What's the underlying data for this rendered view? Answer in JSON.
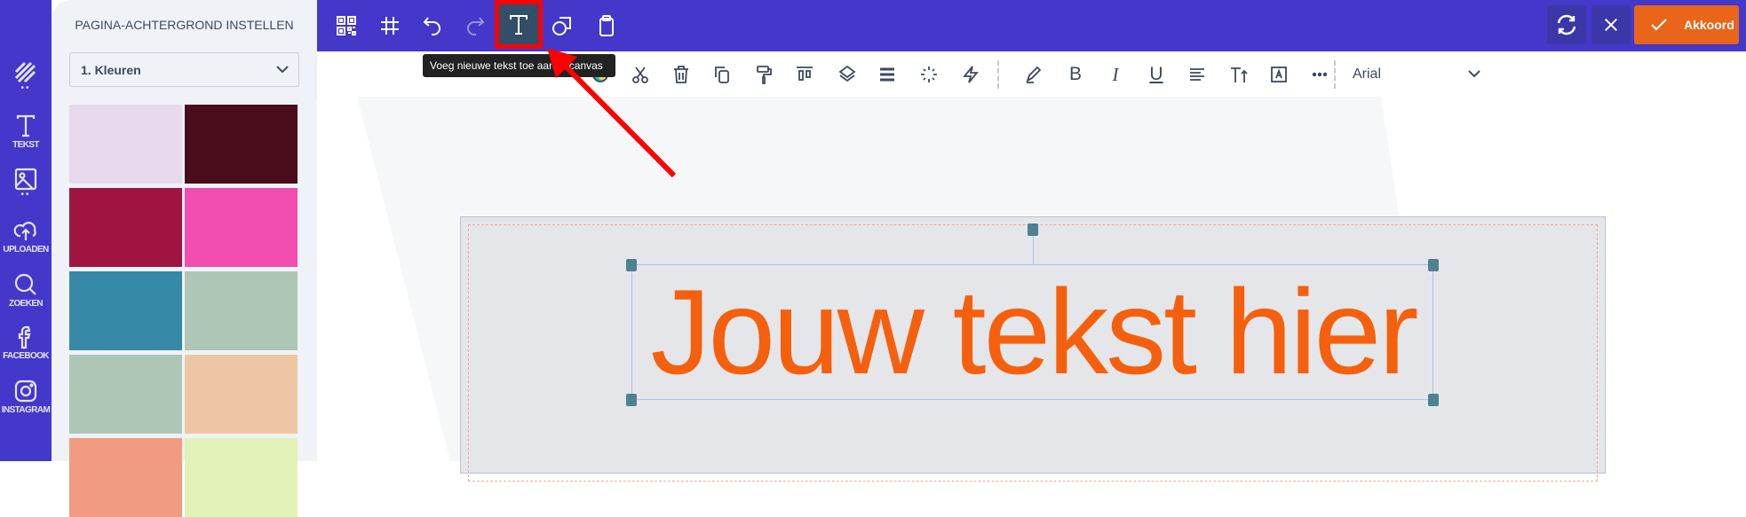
{
  "rail": {
    "items": [
      {
        "icon": "stripes-icon",
        "label": ""
      },
      {
        "icon": "text-icon",
        "label": "TEKST"
      },
      {
        "icon": "image-icon",
        "label": ""
      },
      {
        "icon": "upload-icon",
        "label": "UPLOADEN"
      },
      {
        "icon": "search-icon",
        "label": "ZOEKEN"
      },
      {
        "icon": "facebook-icon",
        "label": "FACEBOOK"
      },
      {
        "icon": "instagram-icon",
        "label": "INSTAGRAM"
      }
    ]
  },
  "panel": {
    "title": "PAGINA-ACHTERGROND INSTELLEN",
    "dropdown_value": "1. Kleuren",
    "swatches": [
      "#e8d9ee",
      "#4b0d1c",
      "#a01442",
      "#f24db0",
      "#3789a8",
      "#aec6b6",
      "#aec6b6",
      "#eec6a4",
      "#f29b83",
      "#e2f2b8"
    ]
  },
  "topbar": {
    "tools": [
      "qr-code-icon",
      "grid-icon",
      "undo-icon",
      "redo-icon",
      "add-text-icon",
      "shapes-icon",
      "clipboard-icon"
    ],
    "tooltip": "Voeg nieuwe tekst toe aan je canvas",
    "accept_label": "Akkoord",
    "accent": "#4338ca",
    "accept_color": "#e8651a"
  },
  "toolbar2": {
    "font": "Arial",
    "bold": "B",
    "italic": "I",
    "underline": "U"
  },
  "canvas": {
    "text": "Jouw tekst hier",
    "text_color": "#f5600e"
  }
}
